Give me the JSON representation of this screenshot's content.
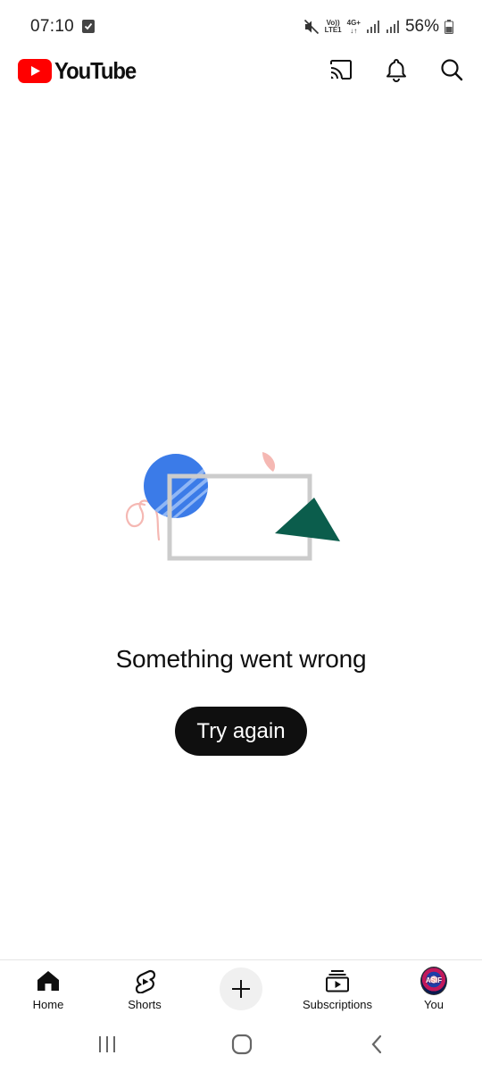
{
  "status_bar": {
    "time": "07:10",
    "volte_top": "Vo))",
    "volte_bottom": "LTE1",
    "network": "4G+",
    "battery": "56%"
  },
  "header": {
    "logo_text": "YouTube",
    "brand_color": "#ff0000",
    "actions": [
      "cast-icon",
      "notifications-icon",
      "search-icon"
    ]
  },
  "error": {
    "message": "Something went wrong",
    "retry_label": "Try again"
  },
  "bottom_nav": {
    "home": "Home",
    "shorts": "Shorts",
    "subscriptions": "Subscriptions",
    "you": "You",
    "avatar_text": "ASIF"
  },
  "colors": {
    "text": "#0f0f0f",
    "button_bg": "#0f0f0f",
    "illustration_blue": "#3b7be8",
    "illustration_green": "#0b5d4c",
    "illustration_pink": "#f5b8b3",
    "illustration_frame": "#cccccc"
  }
}
